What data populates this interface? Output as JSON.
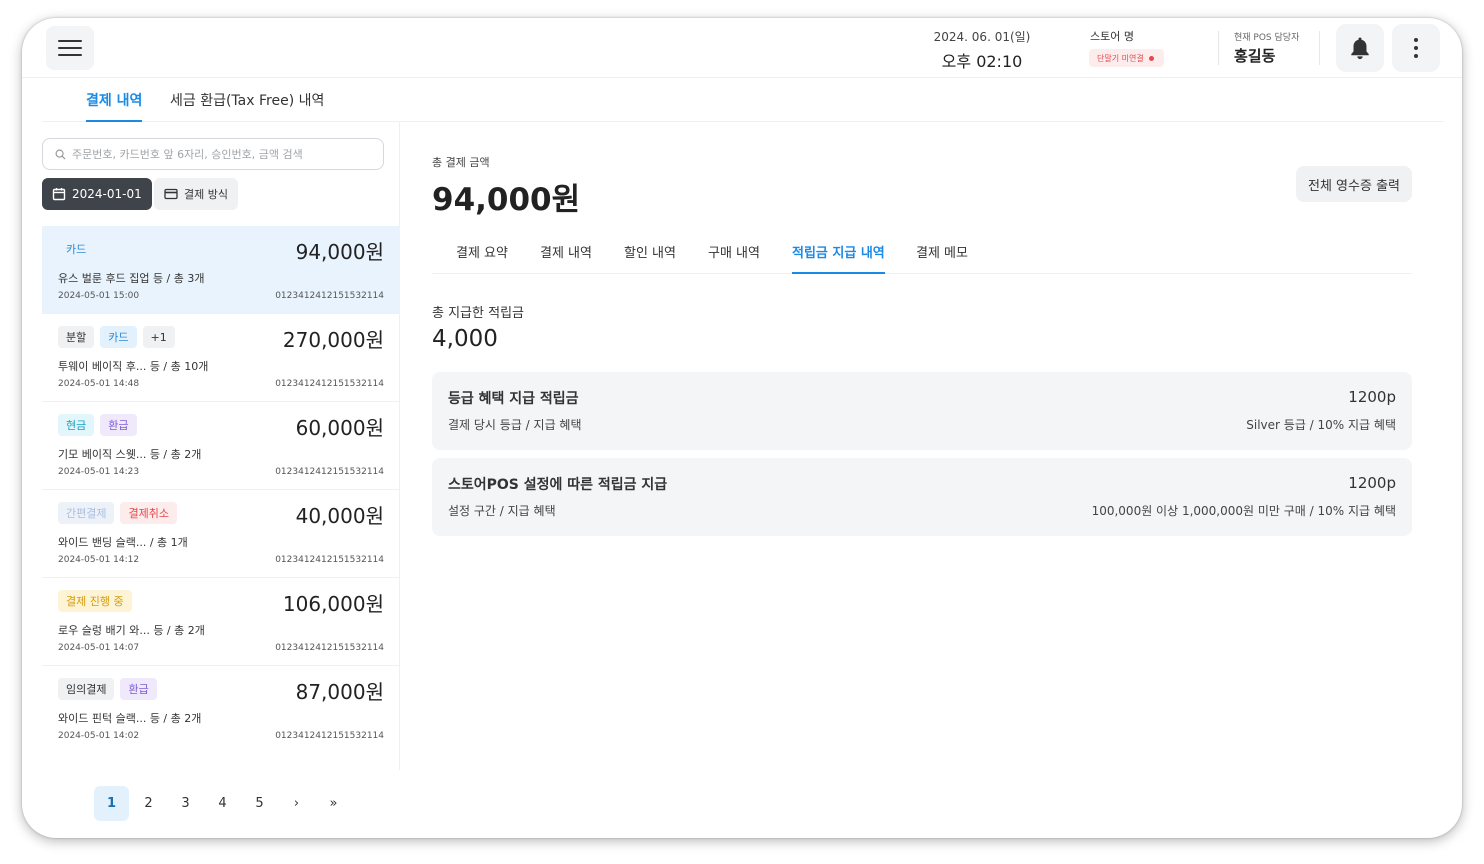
{
  "header": {
    "date": "2024. 06. 01(일)",
    "time": "오후 02:10",
    "store_label": "스토어 명",
    "terminal_status": "단말기 미연결",
    "manager_label": "현재 POS 담당자",
    "manager_name": "홍길동"
  },
  "top_tabs": [
    {
      "label": "결제 내역",
      "active": true
    },
    {
      "label": "세금 환급(Tax Free) 내역",
      "active": false
    }
  ],
  "search": {
    "placeholder": "주문번호, 카드번호 앞 6자리, 승인번호, 금액 검색"
  },
  "filters": {
    "date": "2024-01-01",
    "payment_method": "결제 방식"
  },
  "transactions": [
    {
      "tags": [
        "카드"
      ],
      "amount": "94,000원",
      "desc": "유스 벌룬 후드 집업  등  /  총 3개",
      "time": "2024-05-01 15:00",
      "code": "0123412412151532114"
    },
    {
      "tags": [
        "분할",
        "카드",
        "+1"
      ],
      "amount": "270,000원",
      "desc": "투웨이 베이직 후...  등  /  총 10개",
      "time": "2024-05-01 14:48",
      "code": "0123412412151532114"
    },
    {
      "tags": [
        "현금",
        "환급"
      ],
      "amount": "60,000원",
      "desc": "기모 베이직 스웻...  등  /  총 2개",
      "time": "2024-05-01 14:23",
      "code": "0123412412151532114"
    },
    {
      "tags": [
        "간편결제",
        "결제취소"
      ],
      "amount": "40,000원",
      "desc": "와이드 밴딩 슬랙...     /  총 1개",
      "time": "2024-05-01 14:12",
      "code": "0123412412151532114"
    },
    {
      "tags": [
        "결제 진행 중"
      ],
      "amount": "106,000원",
      "desc": "로우 슬렁 배기 와...  등  /  총 2개",
      "time": "2024-05-01 14:07",
      "code": "0123412412151532114"
    },
    {
      "tags": [
        "임의결제",
        "환급"
      ],
      "amount": "87,000원",
      "desc": "와이드 핀턱 슬랙...  등  /  총 2개",
      "time": "2024-05-01 14:02",
      "code": "0123412412151532114"
    }
  ],
  "pagination": [
    "1",
    "2",
    "3",
    "4",
    "5",
    "›",
    "»"
  ],
  "detail": {
    "total_label": "총 결제 금액",
    "total_amount": "94,000원",
    "print_button": "전체 영수증 출력",
    "sub_tabs": [
      "결제 요약",
      "결제 내역",
      "할인 내역",
      "구매 내역",
      "적립금 지급 내역",
      "결제 메모"
    ],
    "active_sub_tab": "적립금 지급 내역",
    "points_label": "총 지급한 적립금",
    "points_value": "4,000",
    "cards": [
      {
        "title": "등급 혜택 지급 적립금",
        "points": "1200p",
        "sub": "결제 당시 등급 / 지급 혜택",
        "detail": "Silver 등급  /  10% 지급 혜택"
      },
      {
        "title": "스토어POS 설정에 따른 적립금 지급",
        "points": "1200p",
        "sub": "설정 구간 / 지급 혜택",
        "detail": "100,000원 이상 1,000,000원 미만 구매  /  10% 지급 혜택"
      }
    ]
  },
  "colors": {
    "accent": "#1a8ae5",
    "selected_row": "#e8f3fd",
    "error": "#e5484d"
  },
  "icons": [
    "menu-icon",
    "search-icon",
    "calendar-icon",
    "credit-card-icon",
    "bell-icon",
    "more-vertical-icon",
    "chevron-right-icon",
    "double-chevron-right-icon"
  ]
}
